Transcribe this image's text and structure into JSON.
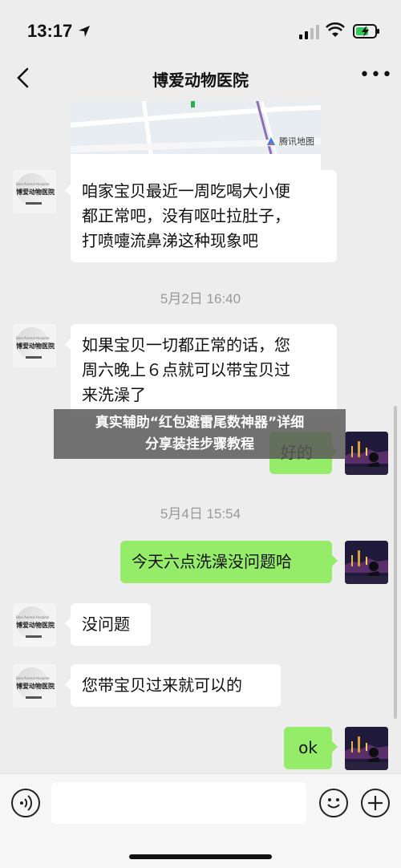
{
  "status_bar": {
    "time": "13:17"
  },
  "header": {
    "title": "博爱动物医院"
  },
  "map_card": {
    "provider": "腾讯地图"
  },
  "hospital_avatar": {
    "line1": "Boai Animal Hospital",
    "line2": "博爱动物医院"
  },
  "messages": [
    {
      "side": "left",
      "text_lines": [
        "咱家宝贝最近一周吃喝大小便",
        "都正常吧，没有呕吐拉肚子，",
        "打喷嚏流鼻涕这种现象吧"
      ]
    },
    {
      "type": "timestamp",
      "text": "5月2日 16:40"
    },
    {
      "side": "left",
      "text_lines": [
        "如果宝贝一切都正常的话，您",
        "周六晚上６点就可以带宝贝过",
        "来洗澡了"
      ]
    },
    {
      "side": "right",
      "text": "好的"
    },
    {
      "type": "timestamp",
      "text": "5月4日 15:54"
    },
    {
      "side": "right",
      "text": "今天六点洗澡没问题哈"
    },
    {
      "side": "left",
      "text": "没问题"
    },
    {
      "side": "left",
      "text": "您带宝贝过来就可以的"
    },
    {
      "side": "right",
      "text": "ok"
    }
  ],
  "overlay_banner": {
    "line1": "真实辅助“红包避雷尾数神器”详细",
    "line2": "分享装挂步骤教程"
  },
  "input": {
    "value": ""
  },
  "icons": {
    "back": "chevron-left-icon",
    "more": "more-horizontal-icon",
    "voice": "voice-icon",
    "emoji": "emoji-icon",
    "plus": "plus-icon"
  },
  "colors": {
    "background": "#ededed",
    "bubble_self": "#95ec69",
    "bubble_other": "#ffffff"
  }
}
